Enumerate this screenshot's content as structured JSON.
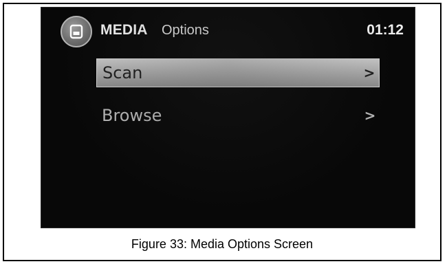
{
  "header": {
    "title": "MEDIA",
    "subtitle": "Options",
    "clock": "01:12",
    "icon": "media-player-icon"
  },
  "menu": {
    "items": [
      {
        "label": "Scan",
        "arrow": ">",
        "selected": true
      },
      {
        "label": "Browse",
        "arrow": ">",
        "selected": false
      }
    ]
  },
  "caption": "Figure 33: Media Options Screen",
  "colors": {
    "screen_background": "#080808",
    "highlight": "#b4b4b4",
    "text_light": "#eeeeee",
    "text_dim": "#b4b4b4"
  }
}
